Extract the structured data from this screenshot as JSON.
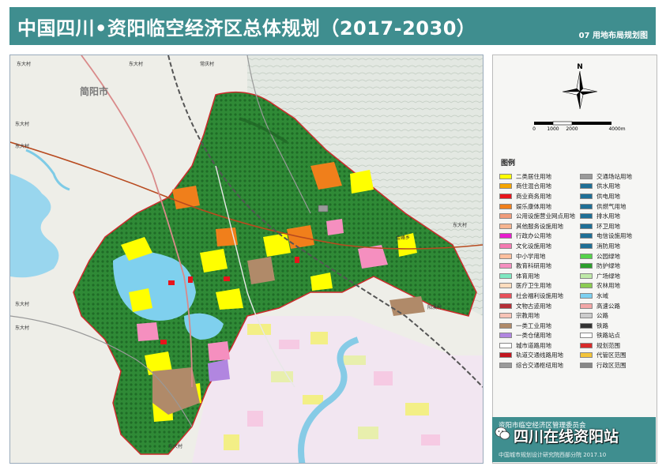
{
  "header": {
    "title": "中国四川•资阳临空经济区总体规划（2017-2030）",
    "subtitle": "07 用地布局规划图"
  },
  "map": {
    "city_label": "简阳市",
    "place_labels": [
      "东大村",
      "东大村",
      "常庆村",
      "东大村",
      "东大村",
      "东大村",
      "金峰乡",
      "阳溪村",
      "东大村",
      "东大村",
      "东大村"
    ]
  },
  "north_arrow": {
    "label": "N"
  },
  "scale_bar": {
    "ticks": [
      "0",
      "1000",
      "2000",
      "4000m"
    ]
  },
  "legend": {
    "title": "图例",
    "left": [
      {
        "label": "二类居住用地",
        "color": "#ffff00"
      },
      {
        "label": "商住混合用地",
        "color": "#f5a500"
      },
      {
        "label": "商业商务用地",
        "color": "#e8141b"
      },
      {
        "label": "娱乐康体用地",
        "color": "#f07f1b"
      },
      {
        "label": "公用设施营业网点用地",
        "color": "#f09c7a"
      },
      {
        "label": "其他服务设施用地",
        "color": "#f6b48f"
      },
      {
        "label": "行政办公用地",
        "color": "#e81ccd"
      },
      {
        "label": "文化设施用地",
        "color": "#f47ab1"
      },
      {
        "label": "中小学用地",
        "color": "#ffbf9d"
      },
      {
        "label": "教育科研用地",
        "color": "#f58fbf"
      },
      {
        "label": "体育用地",
        "color": "#7fe8c1"
      },
      {
        "label": "医疗卫生用地",
        "color": "#ffdcbd"
      },
      {
        "label": "社会福利设施用地",
        "color": "#e8505a"
      },
      {
        "label": "文物古迹用地",
        "color": "#b42e36"
      },
      {
        "label": "宗教用地",
        "color": "#f7c3b6"
      },
      {
        "label": "一类工业用地",
        "color": "#b08a69"
      },
      {
        "label": "一类仓储用地",
        "color": "#b186e0"
      },
      {
        "label": "城市道路用地",
        "color": "#ffffff"
      },
      {
        "label": "轨道交通线路用地",
        "color": "#c2151e"
      },
      {
        "label": "综合交通枢纽用地",
        "color": "#9a9a9a"
      }
    ],
    "right": [
      {
        "label": "交通场站用地",
        "color": "#9a9a9a"
      },
      {
        "label": "供水用地",
        "color": "#1f6f96"
      },
      {
        "label": "供电用地",
        "color": "#1f6f96"
      },
      {
        "label": "供燃气用地",
        "color": "#1f6f96"
      },
      {
        "label": "排水用地",
        "color": "#1f6f96"
      },
      {
        "label": "环卫用地",
        "color": "#1f6f96"
      },
      {
        "label": "电信设施用地",
        "color": "#1f6f96"
      },
      {
        "label": "消防用地",
        "color": "#1f6f96"
      },
      {
        "label": "公园绿地",
        "color": "#55d24b"
      },
      {
        "label": "防护绿地",
        "color": "#2c9e2c"
      },
      {
        "label": "广场绿地",
        "color": "#bfe9a8"
      },
      {
        "label": "农林用地",
        "color": "#8bcb52"
      },
      {
        "label": "水域",
        "color": "#7dd0f0"
      },
      {
        "label": "高速公路",
        "color": "#f2a7a7"
      },
      {
        "label": "公路",
        "color": "#cccccc"
      },
      {
        "label": "铁路",
        "color": "#333333"
      },
      {
        "label": "铁路站点",
        "color": "#ffffff"
      },
      {
        "label": "规划范围",
        "color": "#d82a2a"
      },
      {
        "label": "代管区范围",
        "color": "#f3c43a"
      },
      {
        "label": "行政区范围",
        "color": "#888888"
      }
    ]
  },
  "footer": {
    "org": "资阳市临空经济区管理委员会",
    "designer": "中国城市规划设计研究院西部分院 2017.10",
    "watermark": "四川在线资阳站"
  }
}
